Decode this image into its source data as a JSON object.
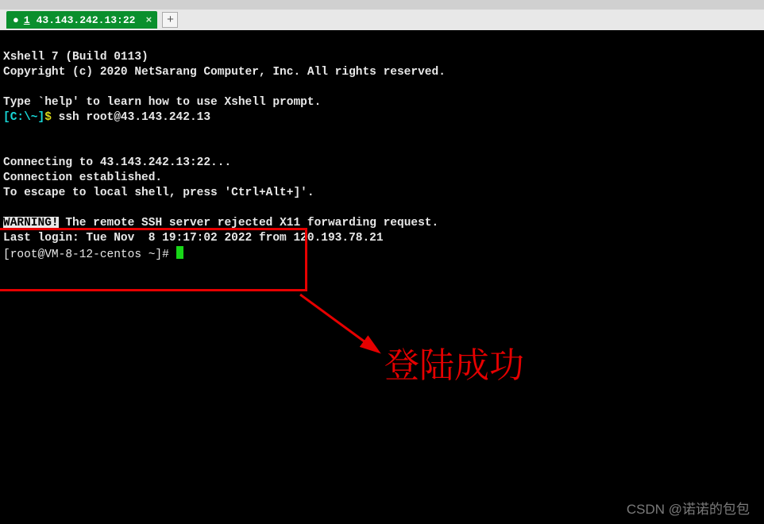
{
  "tab": {
    "index": "1",
    "title": "43.143.242.13:22",
    "close_glyph": "×",
    "add_glyph": "+"
  },
  "term": {
    "banner1": "Xshell 7 (Build 0113)",
    "banner2": "Copyright (c) 2020 NetSarang Computer, Inc. All rights reserved.",
    "help": "Type `help' to learn how to use Xshell prompt.",
    "local_prompt_path": "[C:\\~]",
    "local_prompt_sym": "$",
    "ssh_cmd": " ssh root@43.143.242.13",
    "connecting": "Connecting to 43.143.242.13:22...",
    "established": "Connection established.",
    "escape": "To escape to local shell, press 'Ctrl+Alt+]'.",
    "warning_tag": "WARNING!",
    "warning_rest": " The remote SSH server rejected X11 forwarding request.",
    "lastlogin": "Last login: Tue Nov  8 19:17:02 2022 from 120.193.78.21",
    "remote_prompt": "[root@VM-8-12-centos ~]# "
  },
  "annotation": {
    "text": "登陆成功"
  },
  "watermark": "CSDN @诺诺的包包"
}
